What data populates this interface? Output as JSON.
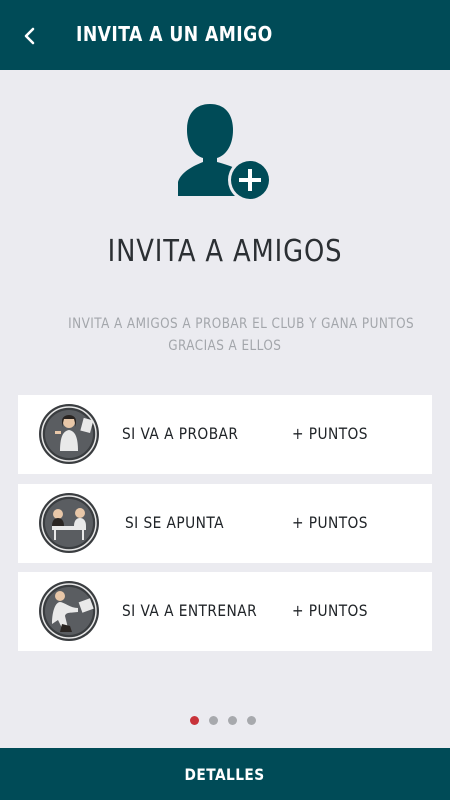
{
  "header": {
    "title": "INVITA A UN AMIGO",
    "back_icon": "chevron-left-icon"
  },
  "hero": {
    "icon": "add-user-icon",
    "heading": "INVITA A AMIGOS",
    "description_line1": "INVITA A AMIGOS A PROBAR EL CLUB Y GANA PUNTOS",
    "description_line2": "GRACIAS A ELLOS"
  },
  "rewards": [
    {
      "icon": "woman-trying-icon",
      "label": "SI VA A PROBAR",
      "points": "+ PUNTOS"
    },
    {
      "icon": "signup-desk-icon",
      "label": "SI SE APUNTA",
      "points": "+ PUNTOS"
    },
    {
      "icon": "woman-training-icon",
      "label": "SI VA A ENTRENAR",
      "points": "+ PUNTOS"
    }
  ],
  "pager": {
    "total": 4,
    "active_index": 0
  },
  "footer": {
    "button_label": "DETALLES"
  },
  "colors": {
    "brand": "#004b57",
    "background": "#ebebf0",
    "active_dot": "#c8323a",
    "inactive_dot": "#a7a9ad"
  }
}
